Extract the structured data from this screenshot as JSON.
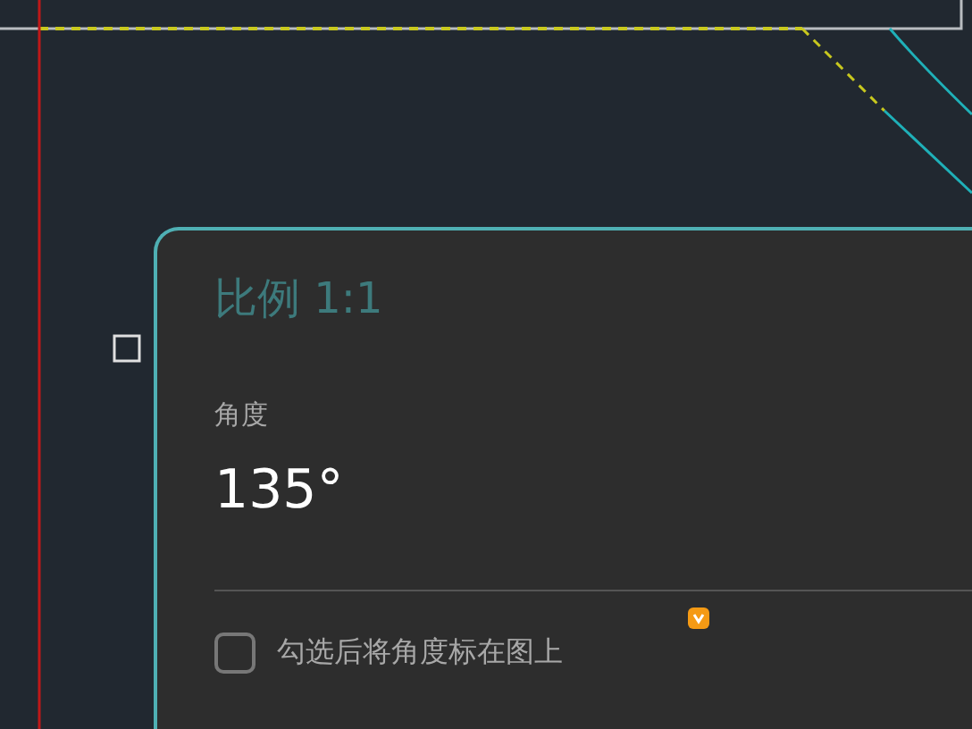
{
  "panel": {
    "title": "比例 1:1",
    "angle_label": "角度",
    "angle_value": "135°",
    "checkbox": {
      "label": "勾选后将角度标在图上",
      "checked": false
    }
  }
}
